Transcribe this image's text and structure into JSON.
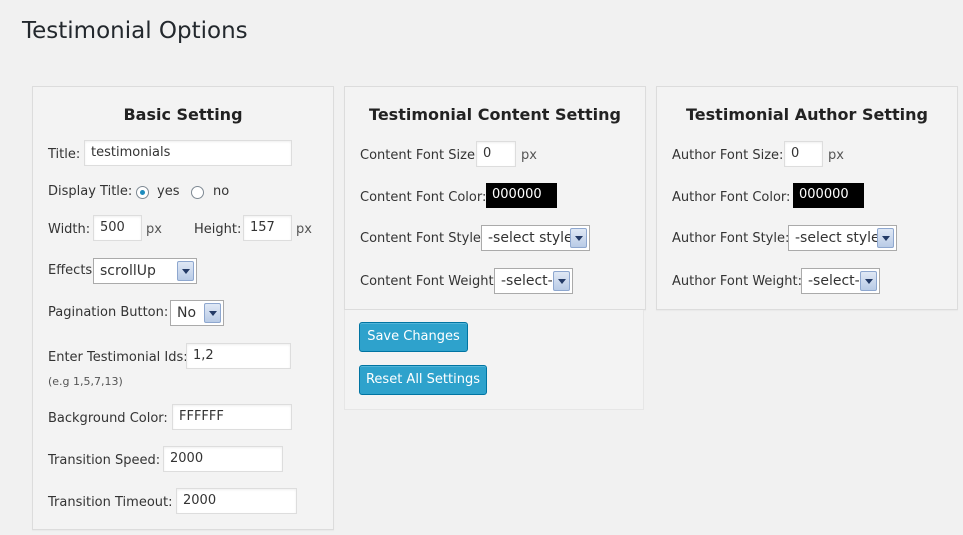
{
  "page_title": "Testimonial Options",
  "basic": {
    "heading": "Basic Setting",
    "title_label": "Title:",
    "title_value": "testimonials",
    "display_title_label": "Display Title:",
    "yes_label": "yes",
    "no_label": "no",
    "display_title_selected": "yes",
    "width_label": "Width:",
    "width_value": "500",
    "width_unit": "px",
    "height_label": "Height:",
    "height_value": "157",
    "height_unit": "px",
    "effects_label": "Effects",
    "effects_value": "scrollUp",
    "pagination_label": "Pagination Button:",
    "pagination_value": "No",
    "ids_label": "Enter Testimonial Ids:",
    "ids_value": "1,2",
    "ids_hint": "(e.g 1,5,7,13)",
    "bg_label": "Background Color:",
    "bg_value": "FFFFFF",
    "speed_label": "Transition Speed:",
    "speed_value": "2000",
    "timeout_label": "Transition Timeout:",
    "timeout_value": "2000"
  },
  "content": {
    "heading": "Testimonial Content Setting",
    "size_label": "Content Font Size:",
    "size_value": "0",
    "size_unit": "px",
    "color_label": "Content Font Color:",
    "color_value": "000000",
    "style_label": "Content Font Style:",
    "style_value": "-select style",
    "weight_label": "Content Font Weight:",
    "weight_value": "-select-"
  },
  "author": {
    "heading": "Testimonial Author Setting",
    "size_label": "Author Font Size:",
    "size_value": "0",
    "size_unit": "px",
    "color_label": "Author Font Color:",
    "color_value": "000000",
    "style_label": "Author Font Style:",
    "style_value": "-select style",
    "weight_label": "Author Font Weight:",
    "weight_value": "-select-"
  },
  "actions": {
    "save_label": "Save Changes",
    "reset_label": "Reset All Settings"
  },
  "colors": {
    "button": "#2ea2cc",
    "swatch": "#000000"
  }
}
